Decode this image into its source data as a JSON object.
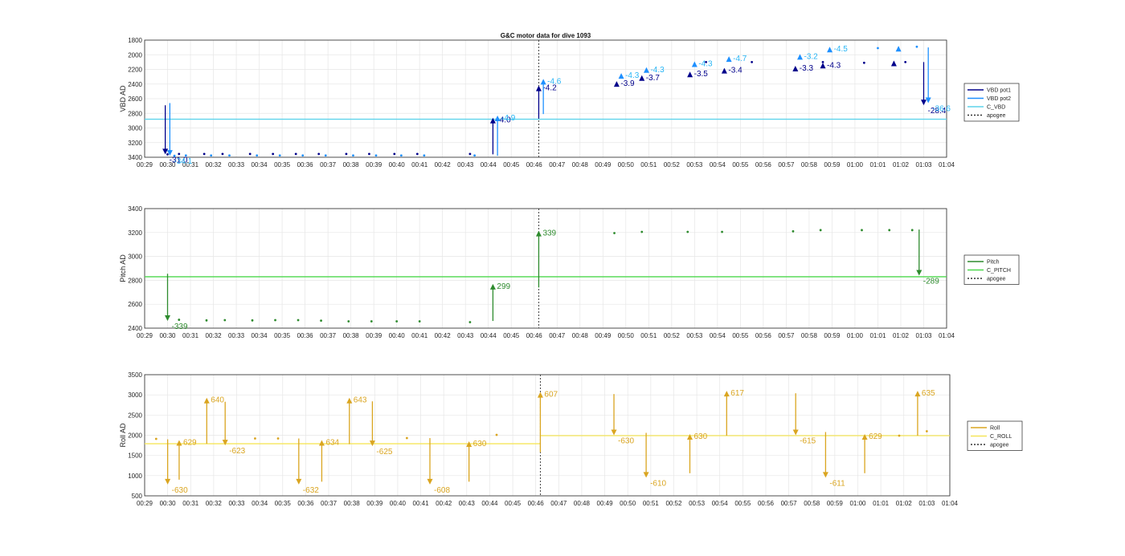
{
  "figure_title": "G&C motor data for dive 1093",
  "chart_data": [
    {
      "type": "line",
      "name": "vbd",
      "title": "G&C motor data for dive 1093",
      "ylabel": "VBD AD",
      "ylim": [
        1800,
        3400
      ],
      "y_reversed": true,
      "yticks": [
        1800,
        2000,
        2200,
        2400,
        2600,
        2800,
        3000,
        3200,
        3400
      ],
      "xlim": [
        29,
        64
      ],
      "xtick_labels": [
        "00:29",
        "00:30",
        "00:31",
        "00:32",
        "00:33",
        "00:34",
        "00:35",
        "00:36",
        "00:37",
        "00:38",
        "00:39",
        "00:40",
        "00:41",
        "00:42",
        "00:43",
        "00:44",
        "00:45",
        "00:46",
        "00:47",
        "00:48",
        "00:49",
        "00:50",
        "00:51",
        "00:52",
        "00:53",
        "00:54",
        "00:55",
        "00:56",
        "00:57",
        "00:58",
        "00:59",
        "01:00",
        "01:01",
        "01:02",
        "01:03",
        "01:04"
      ],
      "grid": true,
      "legend_position": "right",
      "legend": [
        {
          "name": "VBD pot1",
          "color": "#00008B",
          "style": "solid"
        },
        {
          "name": "VBD pot2",
          "color": "#1E90FF",
          "style": "solid"
        },
        {
          "name": "C_VBD",
          "color": "#5fd3ec",
          "style": "solid"
        },
        {
          "name": "apogee",
          "color": "#333333",
          "style": "dotted"
        }
      ],
      "reference_line": {
        "series": "C_VBD",
        "y": 2880
      },
      "apogee_x": 46.2,
      "series": [
        {
          "name": "VBD pot1",
          "color": "#00008B",
          "points": [
            [
              30.0,
              3360
            ],
            [
              30.5,
              3355
            ],
            [
              31.6,
              3355
            ],
            [
              32.4,
              3355
            ],
            [
              33.6,
              3355
            ],
            [
              34.6,
              3355
            ],
            [
              35.6,
              3355
            ],
            [
              36.6,
              3355
            ],
            [
              37.8,
              3355
            ],
            [
              38.8,
              3355
            ],
            [
              39.9,
              3355
            ],
            [
              40.9,
              3355
            ],
            [
              43.2,
              3355
            ],
            [
              53.5,
              2100
            ],
            [
              55.5,
              2100
            ],
            [
              58.6,
              2100
            ],
            [
              60.4,
              2110
            ],
            [
              62.2,
              2100
            ]
          ]
        },
        {
          "name": "VBD pot2",
          "color": "#1E90FF",
          "points": [
            [
              30.3,
              3380
            ],
            [
              30.8,
              3375
            ],
            [
              31.9,
              3375
            ],
            [
              32.7,
              3375
            ],
            [
              33.9,
              3375
            ],
            [
              34.9,
              3375
            ],
            [
              35.9,
              3375
            ],
            [
              36.9,
              3375
            ],
            [
              38.1,
              3375
            ],
            [
              39.1,
              3375
            ],
            [
              40.2,
              3375
            ],
            [
              41.2,
              3375
            ],
            [
              43.4,
              3375
            ],
            [
              61.0,
              1910
            ],
            [
              62.7,
              1890
            ]
          ]
        }
      ],
      "arrows": [
        {
          "x": 29.9,
          "y_start": 2690,
          "y_end": 3360,
          "color": "#00008B",
          "label": "-31.0"
        },
        {
          "x": 30.1,
          "y_start": 2660,
          "y_end": 3380,
          "color": "#1E90FF",
          "label": "-34.1"
        },
        {
          "x": 44.2,
          "y_start": 3360,
          "y_end": 2860,
          "color": "#00008B",
          "label": "-4.0"
        },
        {
          "x": 44.4,
          "y_start": 3380,
          "y_end": 2830,
          "color": "#1E90FF",
          "label": "-4.9"
        },
        {
          "x": 46.2,
          "y_start": 2870,
          "y_end": 2420,
          "color": "#00008B",
          "label": "-4.2"
        },
        {
          "x": 46.4,
          "y_start": 2810,
          "y_end": 2330,
          "color": "#1E90FF",
          "label": "-4.6"
        },
        {
          "x": 49.6,
          "y_start": 2400,
          "y_end": 2360,
          "color": "#00008B",
          "label": "-3.9"
        },
        {
          "x": 49.8,
          "y_start": 2290,
          "y_end": 2250,
          "color": "#1E90FF",
          "label": "-4.3"
        },
        {
          "x": 50.7,
          "y_start": 2320,
          "y_end": 2280,
          "color": "#00008B",
          "label": "-3.7"
        },
        {
          "x": 50.9,
          "y_start": 2210,
          "y_end": 2170,
          "color": "#1E90FF",
          "label": "-4.3"
        },
        {
          "x": 52.8,
          "y_start": 2270,
          "y_end": 2230,
          "color": "#00008B",
          "label": "-3.5"
        },
        {
          "x": 53.0,
          "y_start": 2130,
          "y_end": 2090,
          "color": "#1E90FF",
          "label": "-4.3"
        },
        {
          "x": 54.3,
          "y_start": 2220,
          "y_end": 2180,
          "color": "#00008B",
          "label": "-3.4"
        },
        {
          "x": 54.5,
          "y_start": 2060,
          "y_end": 2020,
          "color": "#1E90FF",
          "label": "-4.7"
        },
        {
          "x": 57.4,
          "y_start": 2190,
          "y_end": 2150,
          "color": "#00008B",
          "label": "-3.3"
        },
        {
          "x": 57.6,
          "y_start": 2030,
          "y_end": 1990,
          "color": "#1E90FF",
          "label": "-3.2"
        },
        {
          "x": 58.6,
          "y_start": 2150,
          "y_end": 2110,
          "color": "#00008B",
          "label": "-4.3"
        },
        {
          "x": 58.9,
          "y_start": 1950,
          "y_end": 1890,
          "color": "#1E90FF",
          "label": "-4.5"
        },
        {
          "x": 61.7,
          "y_start": 2090,
          "y_end": 2080,
          "color": "#00008B",
          "label": ""
        },
        {
          "x": 61.9,
          "y_start": 1890,
          "y_end": 1880,
          "color": "#1E90FF",
          "label": ""
        },
        {
          "x": 63.0,
          "y_start": 2100,
          "y_end": 2690,
          "color": "#00008B",
          "label": "-28.4"
        },
        {
          "x": 63.2,
          "y_start": 1900,
          "y_end": 2660,
          "color": "#1E90FF",
          "label": "-36.6"
        }
      ]
    },
    {
      "type": "line",
      "name": "pitch",
      "ylabel": "Pitch AD",
      "ylim": [
        2400,
        3400
      ],
      "y_reversed": false,
      "yticks": [
        2400,
        2600,
        2800,
        3000,
        3200,
        3400
      ],
      "xlim": [
        29,
        64
      ],
      "grid": true,
      "legend_position": "right",
      "legend": [
        {
          "name": "Pitch",
          "color": "#2E8B2E",
          "style": "solid"
        },
        {
          "name": "C_PITCH",
          "color": "#4cd84c",
          "style": "solid"
        },
        {
          "name": "apogee",
          "color": "#333333",
          "style": "dotted"
        }
      ],
      "reference_line": {
        "series": "C_PITCH",
        "y": 2830
      },
      "apogee_x": 46.2,
      "series": [
        {
          "name": "Pitch",
          "color": "#2E8B2E",
          "points": [
            [
              30.5,
              2470
            ],
            [
              31.7,
              2465
            ],
            [
              32.5,
              2467
            ],
            [
              33.7,
              2465
            ],
            [
              34.7,
              2467
            ],
            [
              35.7,
              2467
            ],
            [
              36.7,
              2463
            ],
            [
              37.9,
              2457
            ],
            [
              38.9,
              2457
            ],
            [
              40.0,
              2457
            ],
            [
              41.0,
              2457
            ],
            [
              43.2,
              2450
            ],
            [
              49.5,
              3195
            ],
            [
              50.7,
              3205
            ],
            [
              52.7,
              3205
            ],
            [
              54.2,
              3205
            ],
            [
              57.3,
              3210
            ],
            [
              58.5,
              3220
            ],
            [
              60.3,
              3220
            ],
            [
              61.5,
              3220
            ],
            [
              62.5,
              3220
            ]
          ]
        }
      ],
      "arrows": [
        {
          "x": 30.0,
          "y_start": 2855,
          "y_end": 2460,
          "color": "#2E8B2E",
          "label": "-339"
        },
        {
          "x": 44.2,
          "y_start": 2460,
          "y_end": 2770,
          "color": "#2E8B2E",
          "label": "299"
        },
        {
          "x": 46.2,
          "y_start": 2740,
          "y_end": 3215,
          "color": "#2E8B2E",
          "label": "339"
        },
        {
          "x": 62.8,
          "y_start": 3225,
          "y_end": 2840,
          "color": "#2E8B2E",
          "label": "-289"
        }
      ]
    },
    {
      "type": "line",
      "name": "roll",
      "ylabel": "Roll AD",
      "ylim": [
        500,
        3500
      ],
      "y_reversed": false,
      "yticks": [
        500,
        1000,
        1500,
        2000,
        2500,
        3000,
        3500
      ],
      "xlim": [
        29,
        64
      ],
      "grid": true,
      "legend_position": "right",
      "legend": [
        {
          "name": "Roll",
          "color": "#DAA520",
          "style": "solid"
        },
        {
          "name": "C_ROLL",
          "color": "#F5E55A",
          "style": "solid"
        },
        {
          "name": "apogee",
          "color": "#333333",
          "style": "dotted"
        }
      ],
      "reference_lines": [
        {
          "series": "C_ROLL",
          "x_start": 29,
          "x_end": 46.2,
          "y": 1790
        },
        {
          "series": "C_ROLL",
          "x_start": 46.2,
          "x_end": 64,
          "y": 1990
        }
      ],
      "apogee_x": 46.2,
      "series": [
        {
          "name": "Roll",
          "color": "#DAA520",
          "points": [
            [
              29.5,
              1910
            ],
            [
              33.8,
              1920
            ],
            [
              34.8,
              1920
            ],
            [
              40.4,
              1930
            ],
            [
              44.3,
              2010
            ],
            [
              61.8,
              1990
            ],
            [
              63.0,
              2100
            ]
          ]
        }
      ],
      "arrows": [
        {
          "x": 30.0,
          "y_start": 1900,
          "y_end": 780,
          "label": "-630"
        },
        {
          "x": 30.5,
          "y_start": 900,
          "y_end": 1880,
          "label": "629"
        },
        {
          "x": 31.7,
          "y_start": 1790,
          "y_end": 2930,
          "label": "640"
        },
        {
          "x": 32.5,
          "y_start": 2830,
          "y_end": 1750,
          "label": "-623"
        },
        {
          "x": 35.7,
          "y_start": 1920,
          "y_end": 780,
          "label": "-632"
        },
        {
          "x": 36.7,
          "y_start": 850,
          "y_end": 1880,
          "label": "634"
        },
        {
          "x": 37.9,
          "y_start": 1780,
          "y_end": 2930,
          "label": "643"
        },
        {
          "x": 38.9,
          "y_start": 2840,
          "y_end": 1730,
          "label": "-625"
        },
        {
          "x": 41.4,
          "y_start": 1930,
          "y_end": 780,
          "label": "-608"
        },
        {
          "x": 43.1,
          "y_start": 850,
          "y_end": 1850,
          "label": "630"
        },
        {
          "x": 46.2,
          "y_start": 1580,
          "y_end": 3070,
          "label": "607"
        },
        {
          "x": 49.4,
          "y_start": 3020,
          "y_end": 2000,
          "label": "-630"
        },
        {
          "x": 50.8,
          "y_start": 2060,
          "y_end": 950,
          "label": "-610"
        },
        {
          "x": 52.7,
          "y_start": 1060,
          "y_end": 2030,
          "label": "630"
        },
        {
          "x": 54.3,
          "y_start": 1990,
          "y_end": 3100,
          "label": "617"
        },
        {
          "x": 57.3,
          "y_start": 3040,
          "y_end": 2000,
          "label": "-615"
        },
        {
          "x": 58.6,
          "y_start": 2080,
          "y_end": 950,
          "label": "-611"
        },
        {
          "x": 60.3,
          "y_start": 1060,
          "y_end": 2030,
          "label": "629"
        },
        {
          "x": 62.6,
          "y_start": 1990,
          "y_end": 3100,
          "label": "635"
        }
      ]
    }
  ]
}
